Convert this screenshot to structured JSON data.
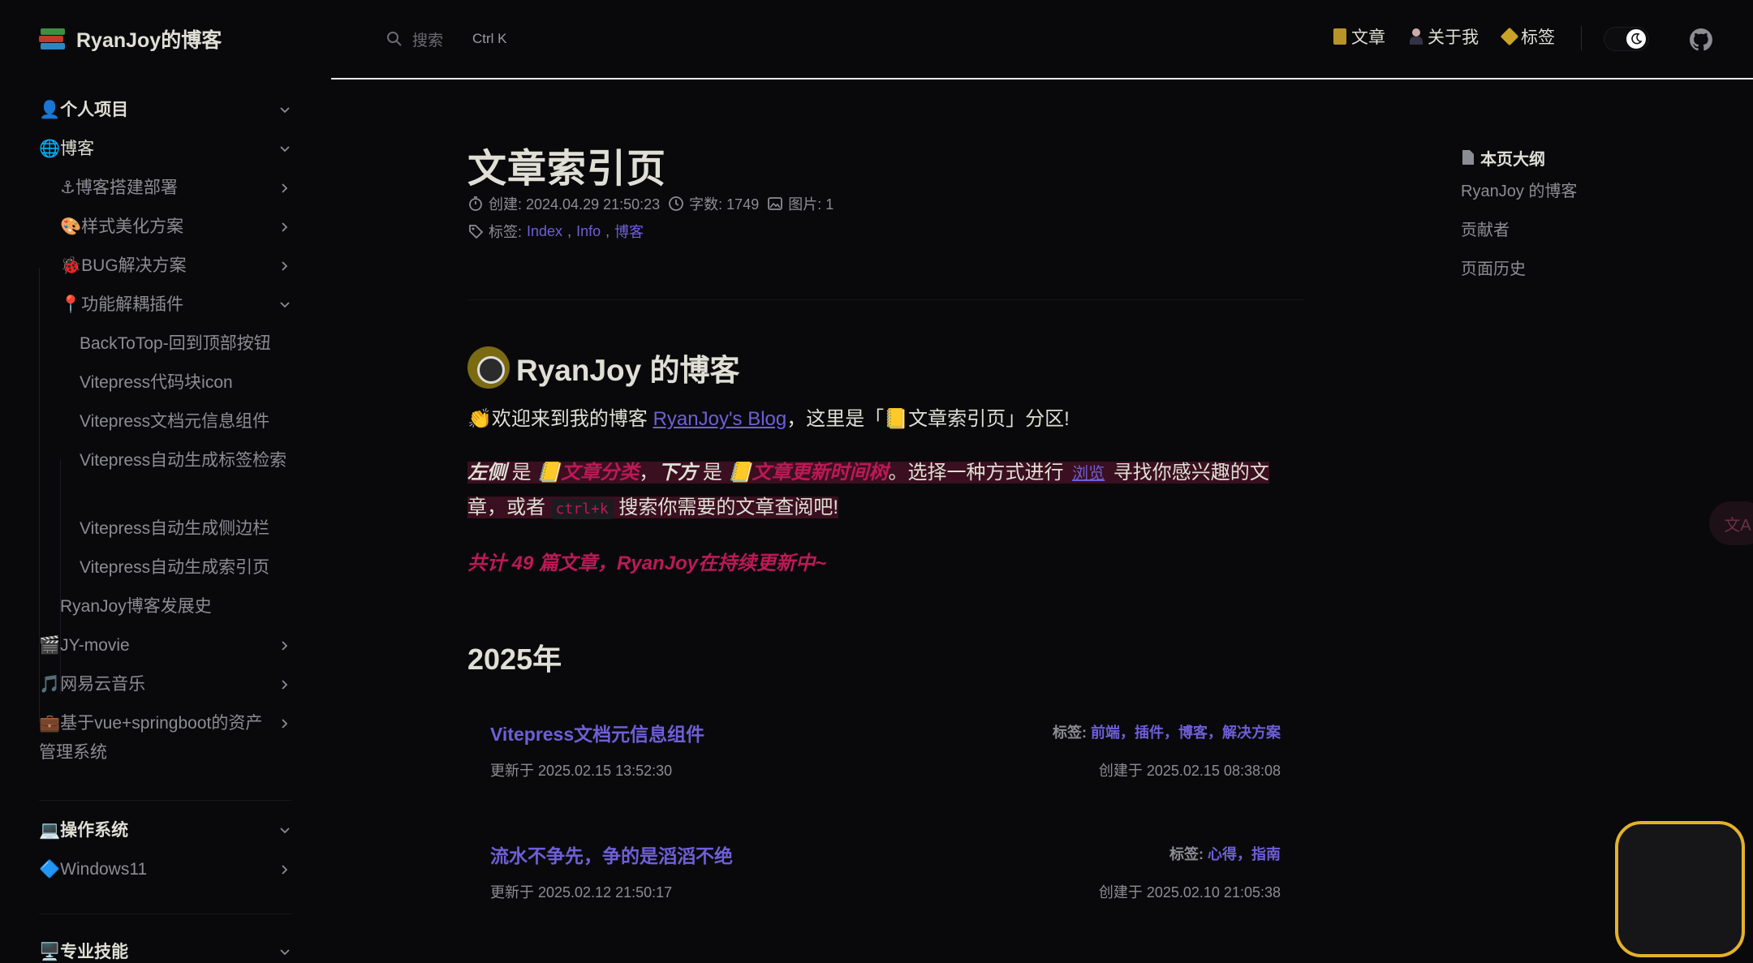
{
  "header": {
    "brand_title": "RyanJoy的博客",
    "search_placeholder": "搜索",
    "search_shortcut": "Ctrl K",
    "nav": [
      {
        "label": "文章",
        "icon": "notebook-icon"
      },
      {
        "label": "关于我",
        "icon": "person-icon"
      },
      {
        "label": "标签",
        "icon": "tag-icon"
      }
    ]
  },
  "sidebar": {
    "items": [
      {
        "label": "👤个人项目"
      },
      {
        "label": "🌐博客"
      },
      {
        "label": "⚓博客搭建部署"
      },
      {
        "label": "🎨样式美化方案"
      },
      {
        "label": "🐞BUG解决方案"
      },
      {
        "label": "📍功能解耦插件"
      },
      {
        "label": "BackToTop-回到顶部按钮"
      },
      {
        "label": "Vitepress代码块icon"
      },
      {
        "label": "Vitepress文档元信息组件"
      },
      {
        "label": "Vitepress自动生成标签检索"
      },
      {
        "label": "Vitepress自动生成侧边栏"
      },
      {
        "label": "Vitepress自动生成索引页"
      },
      {
        "label": "RyanJoy博客发展史"
      },
      {
        "label": "🎬JY-movie"
      },
      {
        "label": "🎵网易云音乐"
      },
      {
        "label": "💼基于vue+springboot的资产管理系统"
      },
      {
        "label": "💻操作系统"
      },
      {
        "label": "🔷Windows11"
      },
      {
        "label": "🖥️专业技能"
      }
    ]
  },
  "main": {
    "title": "文章索引页",
    "meta": {
      "created": "创建: 2024.04.29 21:50:23",
      "words": "字数: 1749",
      "images": "图片: 1",
      "tags_label": "标签:",
      "tags": [
        "Index",
        "Info",
        "博客"
      ],
      "tag_sep": ","
    },
    "heading": "RyanJoy 的博客",
    "intro_a": "👏欢迎来到我的博客 ",
    "intro_link": "RyanJoy's Blog",
    "intro_b": "，这里是「📒文章索引页」分区!",
    "p2": {
      "left": "左侧",
      "is1": " 是 ",
      "cat": "📒文章分类",
      "comma": "，",
      "down": "下方",
      "is2": " 是 ",
      "tree": "📒文章更新时间树",
      "mid": "。选择一种方式进行 ",
      "browse": "浏览",
      "after": " 寻找你感兴趣的文章，或者 ",
      "code": "ctrl+k",
      "end": " 搜索你需要的文章查阅吧!"
    },
    "total": "共计 49 篇文章，RyanJoy在持续更新中~",
    "year": "2025年",
    "articles": [
      {
        "title": "Vitepress文档元信息组件",
        "tags_label": "标签: ",
        "tags": "前端，插件，博客，解决方案",
        "updated": "更新于 2025.02.15 13:52:30",
        "created": "创建于 2025.02.15 08:38:08"
      },
      {
        "title": "流水不争先，争的是滔滔不绝",
        "tags_label": "标签: ",
        "tags": "心得，指南",
        "updated": "更新于 2025.02.12 21:50:17",
        "created": "创建于 2025.02.10 21:05:38"
      }
    ]
  },
  "outline": {
    "title": "本页大纲",
    "items": [
      "RyanJoy 的博客",
      "贡献者",
      "页面历史"
    ]
  },
  "floating": {
    "translate_label": "文A"
  },
  "colors": {
    "background": "#09090b",
    "text": "#dfdfd6",
    "muted": "#8c8c94",
    "link": "#6e5fd8",
    "accent_red": "#bb1a55",
    "widget_border": "#e3b22b"
  }
}
